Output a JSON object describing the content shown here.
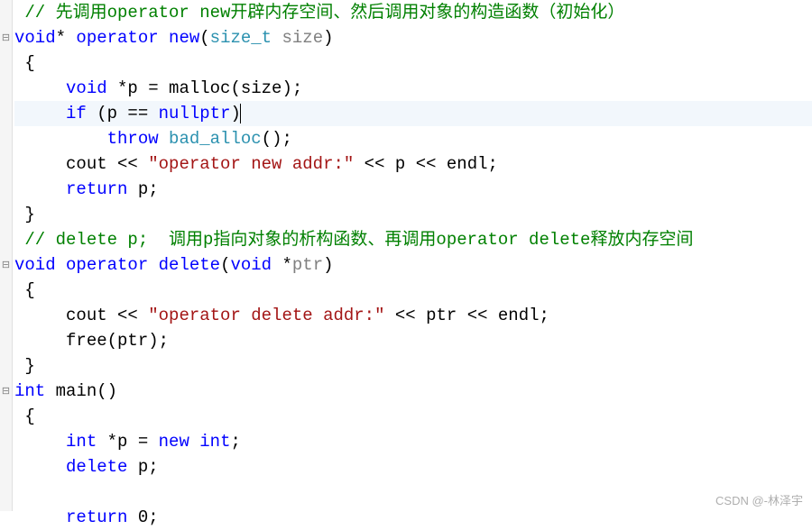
{
  "gutter": {
    "fold_marks": [
      "",
      "⊟",
      "",
      "",
      "",
      "",
      "",
      "",
      "",
      "",
      "⊟",
      "",
      "",
      "",
      "",
      "⊟",
      "",
      "",
      "",
      "",
      ""
    ]
  },
  "code": {
    "lines": [
      {
        "seg": [
          {
            "cls": "c-default",
            "t": " "
          },
          {
            "cls": "c-comment",
            "t": "// 先调用operator new开辟内存空间、然后调用对象的构造函数（初始化）"
          }
        ]
      },
      {
        "seg": [
          {
            "cls": "c-keyword",
            "t": "void"
          },
          {
            "cls": "c-default",
            "t": "* "
          },
          {
            "cls": "c-keyword",
            "t": "operator"
          },
          {
            "cls": "c-default",
            "t": " "
          },
          {
            "cls": "c-keyword",
            "t": "new"
          },
          {
            "cls": "c-default",
            "t": "("
          },
          {
            "cls": "c-type",
            "t": "size_t"
          },
          {
            "cls": "c-default",
            "t": " "
          },
          {
            "cls": "c-gray",
            "t": "size"
          },
          {
            "cls": "c-default",
            "t": ")"
          }
        ]
      },
      {
        "seg": [
          {
            "cls": "c-default",
            "t": " {"
          }
        ]
      },
      {
        "seg": [
          {
            "cls": "c-default",
            "t": "     "
          },
          {
            "cls": "c-keyword",
            "t": "void"
          },
          {
            "cls": "c-default",
            "t": " *p = malloc(size);"
          }
        ]
      },
      {
        "highlighted": true,
        "seg": [
          {
            "cls": "c-default",
            "t": "     "
          },
          {
            "cls": "c-keyword",
            "t": "if"
          },
          {
            "cls": "c-default",
            "t": " (p == "
          },
          {
            "cls": "c-keyword",
            "t": "nullptr"
          },
          {
            "cls": "c-default",
            "t": ")"
          },
          {
            "cls": "caret",
            "t": ""
          }
        ]
      },
      {
        "seg": [
          {
            "cls": "c-default",
            "t": "         "
          },
          {
            "cls": "c-keyword",
            "t": "throw"
          },
          {
            "cls": "c-default",
            "t": " "
          },
          {
            "cls": "c-type",
            "t": "bad_alloc"
          },
          {
            "cls": "c-default",
            "t": "();"
          }
        ]
      },
      {
        "seg": [
          {
            "cls": "c-default",
            "t": "     cout << "
          },
          {
            "cls": "c-string",
            "t": "\"operator new addr:\""
          },
          {
            "cls": "c-default",
            "t": " << p << endl;"
          }
        ]
      },
      {
        "seg": [
          {
            "cls": "c-default",
            "t": "     "
          },
          {
            "cls": "c-keyword",
            "t": "return"
          },
          {
            "cls": "c-default",
            "t": " p;"
          }
        ]
      },
      {
        "seg": [
          {
            "cls": "c-default",
            "t": " }"
          }
        ]
      },
      {
        "seg": [
          {
            "cls": "c-default",
            "t": " "
          },
          {
            "cls": "c-comment",
            "t": "// delete p;  调用p指向对象的析构函数、再调用operator delete释放内存空间"
          }
        ]
      },
      {
        "seg": [
          {
            "cls": "c-keyword",
            "t": "void"
          },
          {
            "cls": "c-default",
            "t": " "
          },
          {
            "cls": "c-keyword",
            "t": "operator"
          },
          {
            "cls": "c-default",
            "t": " "
          },
          {
            "cls": "c-keyword",
            "t": "delete"
          },
          {
            "cls": "c-default",
            "t": "("
          },
          {
            "cls": "c-keyword",
            "t": "void"
          },
          {
            "cls": "c-default",
            "t": " *"
          },
          {
            "cls": "c-gray",
            "t": "ptr"
          },
          {
            "cls": "c-default",
            "t": ")"
          }
        ]
      },
      {
        "seg": [
          {
            "cls": "c-default",
            "t": " {"
          }
        ]
      },
      {
        "seg": [
          {
            "cls": "c-default",
            "t": "     cout << "
          },
          {
            "cls": "c-string",
            "t": "\"operator delete addr:\""
          },
          {
            "cls": "c-default",
            "t": " << ptr << endl;"
          }
        ]
      },
      {
        "seg": [
          {
            "cls": "c-default",
            "t": "     free(ptr);"
          }
        ]
      },
      {
        "seg": [
          {
            "cls": "c-default",
            "t": " }"
          }
        ]
      },
      {
        "seg": [
          {
            "cls": "c-keyword",
            "t": "int"
          },
          {
            "cls": "c-default",
            "t": " main()"
          }
        ]
      },
      {
        "seg": [
          {
            "cls": "c-default",
            "t": " {"
          }
        ]
      },
      {
        "seg": [
          {
            "cls": "c-default",
            "t": "     "
          },
          {
            "cls": "c-keyword",
            "t": "int"
          },
          {
            "cls": "c-default",
            "t": " *p = "
          },
          {
            "cls": "c-keyword",
            "t": "new"
          },
          {
            "cls": "c-default",
            "t": " "
          },
          {
            "cls": "c-keyword",
            "t": "int"
          },
          {
            "cls": "c-default",
            "t": ";"
          }
        ]
      },
      {
        "seg": [
          {
            "cls": "c-default",
            "t": "     "
          },
          {
            "cls": "c-keyword",
            "t": "delete"
          },
          {
            "cls": "c-default",
            "t": " p;"
          }
        ]
      },
      {
        "seg": [
          {
            "cls": "c-default",
            "t": ""
          }
        ]
      },
      {
        "seg": [
          {
            "cls": "c-default",
            "t": "     "
          },
          {
            "cls": "c-keyword",
            "t": "return"
          },
          {
            "cls": "c-default",
            "t": " 0;"
          }
        ]
      }
    ]
  },
  "watermark": "CSDN @-林泽宇"
}
